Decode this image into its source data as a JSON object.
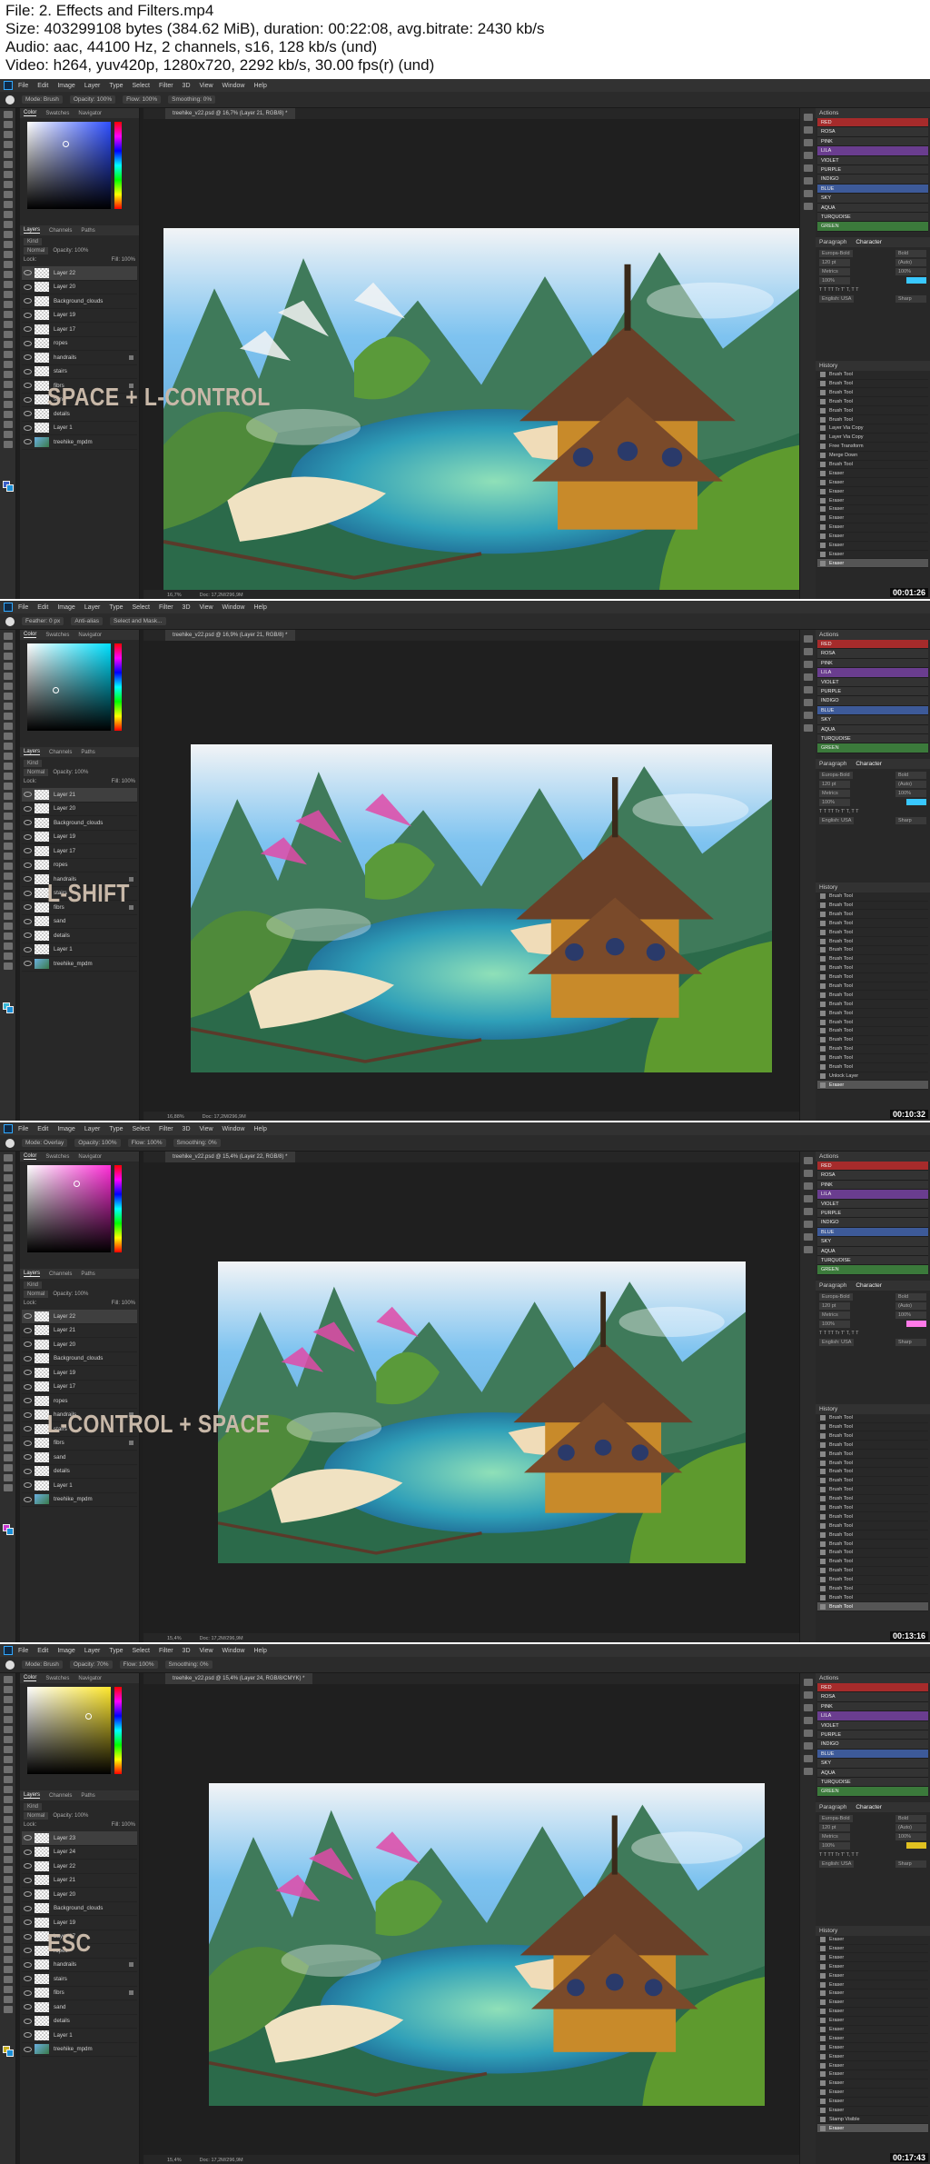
{
  "header": {
    "file_line": "File: 2. Effects and Filters.mp4",
    "size_line": "Size: 403299108 bytes (384.62 MiB), duration: 00:22:08, avg.bitrate: 2430 kb/s",
    "audio_line": "Audio: aac, 44100 Hz, 2 channels, s16, 128 kb/s (und)",
    "video_line": "Video: h264, yuv420p, 1280x720, 2292 kb/s, 30.00 fps(r) (und)"
  },
  "menu": [
    "File",
    "Edit",
    "Image",
    "Layer",
    "Type",
    "Select",
    "Filter",
    "3D",
    "View",
    "Window",
    "Help"
  ],
  "actions": [
    "RED",
    "ROSA",
    "PINK",
    "LILA",
    "VIOLET",
    "PURPLE",
    "INDIGO",
    "BLUE",
    "SKY",
    "AQUA",
    "TURQUOISE",
    "GREEN"
  ],
  "action_colors": [
    "#a62b2b",
    "#333333",
    "#333333",
    "#6a3d8f",
    "#333333",
    "#333333",
    "#333333",
    "#3d5a99",
    "#333333",
    "#333333",
    "#333333",
    "#3b7a3b"
  ],
  "panels": {
    "color_tab": "Color",
    "swatches_tab": "Swatches",
    "navigator_tab": "Navigator",
    "layers_tab": "Layers",
    "channels_tab": "Channels",
    "paths_tab": "Paths",
    "actions_title": "Actions",
    "paragraph_tab": "Paragraph",
    "character_tab": "Character",
    "history_title": "History",
    "kind": "Kind",
    "blend": "Normal",
    "opacity": "Opacity: 100%",
    "fill": "Fill: 100%",
    "lock": "Lock:",
    "font": "Europa-Bold",
    "font_style": "Bold",
    "font_size": "120 pt",
    "leading": "(Auto)",
    "tracking": "Metrics",
    "scale": "100%",
    "language": "English: USA",
    "aa": "Sharp"
  },
  "frames": [
    {
      "shortcut": "SPACE + L-CONTROL",
      "timestamp": "00:01:26",
      "options": [
        "Mode: Brush",
        "Opacity: 100%",
        "Flow: 100%",
        "Smoothing: 0%"
      ],
      "doc_tab": "treehike_v22.psd @ 16,7% (Layer 21, RGB/8) *",
      "status": [
        "16,7%",
        "Doc: 17,2M/296,9M"
      ],
      "color_hue": "#2e4fff",
      "fg_color": "#3a5fc8",
      "layers": [
        "Layer 22",
        "Layer 20",
        "Background_clouds",
        "Layer 19",
        "Layer 17",
        "ropes",
        "handrails",
        "stairs",
        "fibrs",
        "sand",
        "details",
        "Layer 1",
        "treehike_mpdm"
      ],
      "history": [
        "Brush Tool",
        "Brush Tool",
        "Brush Tool",
        "Brush Tool",
        "Brush Tool",
        "Brush Tool",
        "Layer Via Copy",
        "Layer Via Copy",
        "Free Transform",
        "Merge Down",
        "Brush Tool",
        "Eraser",
        "Eraser",
        "Eraser",
        "Eraser",
        "Eraser",
        "Eraser",
        "Eraser",
        "Eraser",
        "Eraser",
        "Eraser",
        "Eraser"
      ]
    },
    {
      "shortcut": "L-SHIFT",
      "timestamp": "00:10:32",
      "options": [
        "Feather: 0 px",
        "Anti-alias",
        "Select and Mask..."
      ],
      "doc_tab": "treehike_v22.psd @ 16,9% (Layer 21, RGB/8) *",
      "status": [
        "16,88%",
        "Doc: 17,2M/296,9M"
      ],
      "color_hue": "#00e0ff",
      "fg_color": "#38b8d8",
      "layers": [
        "Layer 21",
        "Layer 20",
        "Background_clouds",
        "Layer 19",
        "Layer 17",
        "ropes",
        "handrails",
        "stairs",
        "fibrs",
        "sand",
        "details",
        "Layer 1",
        "treehike_mpdm"
      ],
      "history": [
        "Brush Tool",
        "Brush Tool",
        "Brush Tool",
        "Brush Tool",
        "Brush Tool",
        "Brush Tool",
        "Brush Tool",
        "Brush Tool",
        "Brush Tool",
        "Brush Tool",
        "Brush Tool",
        "Brush Tool",
        "Brush Tool",
        "Brush Tool",
        "Brush Tool",
        "Brush Tool",
        "Brush Tool",
        "Brush Tool",
        "Brush Tool",
        "Brush Tool",
        "Unlock Layer",
        "Eraser"
      ]
    },
    {
      "shortcut": "L-CONTROL + SPACE",
      "timestamp": "00:13:16",
      "options": [
        "Mode: Overlay",
        "Opacity: 100%",
        "Flow: 100%",
        "Smoothing: 0%"
      ],
      "doc_tab": "treehike_v22.psd @ 15,4% (Layer 22, RGB/8) *",
      "status": [
        "15,4%",
        "Doc: 17,2M/296,9M"
      ],
      "color_hue": "#ff2fd8",
      "fg_color": "#c838d0",
      "layers": [
        "Layer 22",
        "Layer 21",
        "Layer 20",
        "Background_clouds",
        "Layer 19",
        "Layer 17",
        "ropes",
        "handrails",
        "stairs",
        "fibrs",
        "sand",
        "details",
        "Layer 1",
        "treehike_mpdm"
      ],
      "history": [
        "Brush Tool",
        "Brush Tool",
        "Brush Tool",
        "Brush Tool",
        "Brush Tool",
        "Brush Tool",
        "Brush Tool",
        "Brush Tool",
        "Brush Tool",
        "Brush Tool",
        "Brush Tool",
        "Brush Tool",
        "Brush Tool",
        "Brush Tool",
        "Brush Tool",
        "Brush Tool",
        "Brush Tool",
        "Brush Tool",
        "Brush Tool",
        "Brush Tool",
        "Brush Tool",
        "Brush Tool"
      ]
    },
    {
      "shortcut": "ESC",
      "timestamp": "00:17:43",
      "options": [
        "Mode: Brush",
        "Opacity: 70%",
        "Flow: 100%",
        "Smoothing: 0%"
      ],
      "doc_tab": "treehike_v22.psd @ 15,4% (Layer 24, RGB/8/CMYK) *",
      "status": [
        "15,4%",
        "Doc: 17,2M/296,9M"
      ],
      "color_hue": "#ffe82e",
      "fg_color": "#c8b020",
      "layers": [
        "Layer 23",
        "Layer 24",
        "Layer 22",
        "Layer 21",
        "Layer 20",
        "Background_clouds",
        "Layer 19",
        "Layer 17",
        "ropes",
        "handrails",
        "stairs",
        "fibrs",
        "sand",
        "details",
        "Layer 1",
        "treehike_mpdm"
      ],
      "history": [
        "Eraser",
        "Eraser",
        "Eraser",
        "Eraser",
        "Eraser",
        "Eraser",
        "Eraser",
        "Eraser",
        "Eraser",
        "Eraser",
        "Eraser",
        "Eraser",
        "Eraser",
        "Eraser",
        "Eraser",
        "Eraser",
        "Eraser",
        "Eraser",
        "Eraser",
        "Eraser",
        "Stamp Visible",
        "Eraser"
      ]
    }
  ]
}
